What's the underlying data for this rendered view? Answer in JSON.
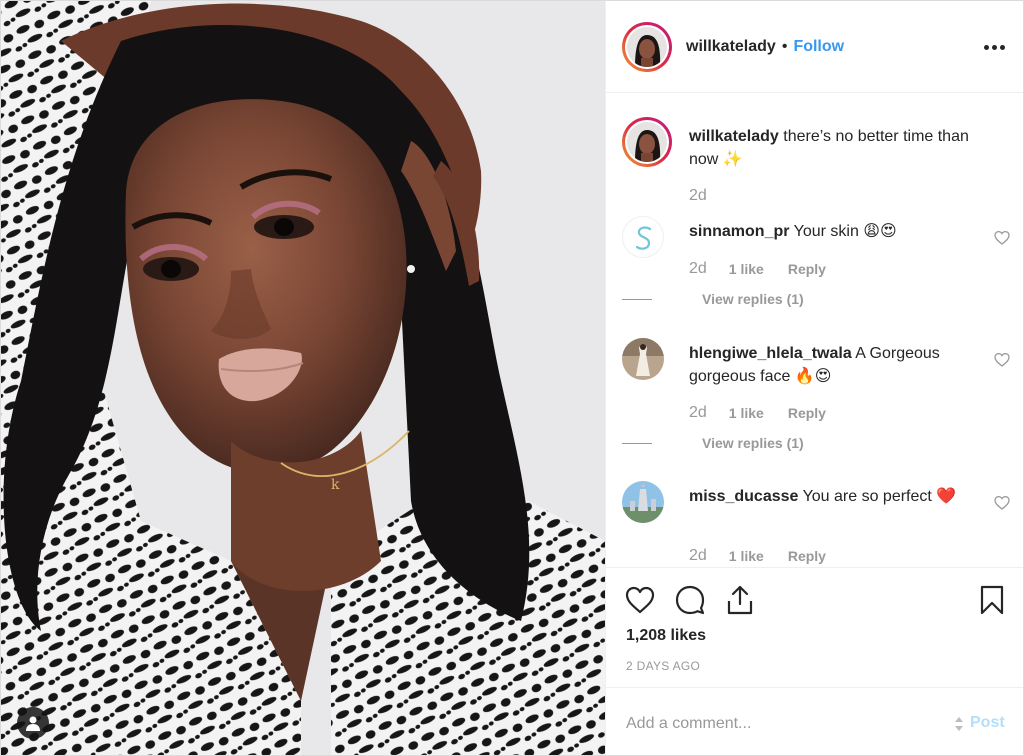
{
  "post": {
    "username": "willkatelady",
    "separator": "•",
    "follow_label": "Follow",
    "likes": "1,208 likes",
    "posted_ago": "2 DAYS AGO"
  },
  "caption": {
    "username": "willkatelady",
    "text": "there’s no better time than now ✨",
    "time": "2d"
  },
  "comments": [
    {
      "username": "sinnamon_pr",
      "text": "Your skin 😩😍",
      "time": "2d",
      "likes": "1 like",
      "reply_label": "Reply",
      "view_replies": "View replies (1)"
    },
    {
      "username": "hlengiwe_hlela_twala",
      "text": "A Gorgeous gorgeous face 🔥😍",
      "time": "2d",
      "likes": "1 like",
      "reply_label": "Reply",
      "view_replies": "View replies (1)"
    },
    {
      "username": "miss_ducasse",
      "text": "You are so perfect ❤️",
      "time": "2d",
      "likes": "1 like",
      "reply_label": "Reply"
    }
  ],
  "add_comment": {
    "placeholder": "Add a comment...",
    "post_label": "Post"
  },
  "icons": {
    "like": "heart-icon",
    "comment": "comment-bubble-icon",
    "share": "share-icon",
    "save": "bookmark-icon",
    "more": "more-options-icon",
    "user_tag": "user-tag-icon"
  },
  "colors": {
    "accent": "#3897f0",
    "post_disabled": "#b2dffc",
    "muted": "#999999",
    "text": "#262626"
  }
}
